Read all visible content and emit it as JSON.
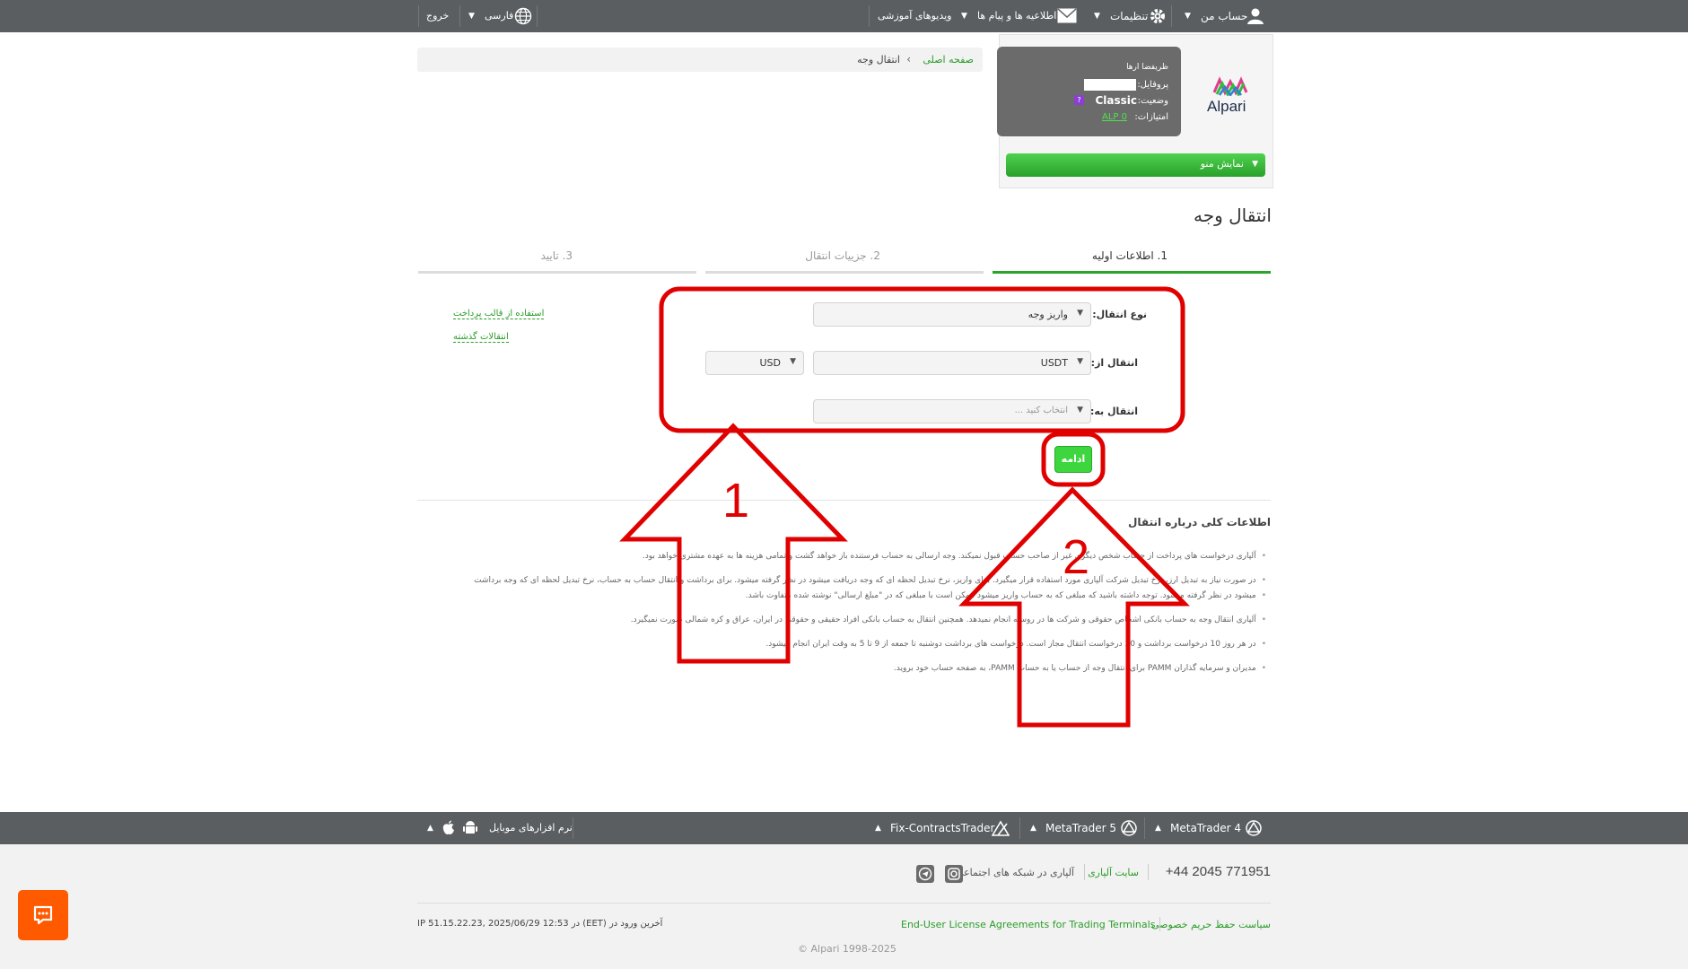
{
  "topbar": {
    "account": "حساب من",
    "settings": "تنظیمات",
    "messages": "اطلاعیه ها و پیام ها",
    "videos": "ویدیوهای آموزشی",
    "language": "فارسی",
    "logout": "خروج"
  },
  "breadcrumb": {
    "home": "صفحه اصلی",
    "current": "انتقال وجه"
  },
  "profile": {
    "name_label": "ظریفضا ارها",
    "profile_label": "پروفایل:",
    "status_label": "وضعیت:",
    "status_value": "Classic",
    "points_label": "امتیازات:",
    "points_value": "ALP 0",
    "menu_button": "نمایش منو",
    "logo_text": "Alpari"
  },
  "page": {
    "title": "انتقال وجه"
  },
  "steps": [
    {
      "label": "1. اطلاعات اولیه",
      "active": true
    },
    {
      "label": "2. جزییات انتقال",
      "active": false
    },
    {
      "label": "3. تایید",
      "active": false
    }
  ],
  "form": {
    "transfer_type": {
      "label": "نوع انتقال:",
      "value": "واریز وجه"
    },
    "from": {
      "label": "انتقال از:",
      "value": "USDT",
      "currency": "USD"
    },
    "to": {
      "label": "انتقال به:",
      "placeholder": "انتخاب کنید ..."
    },
    "continue_button": "ادامه",
    "links": {
      "template": "استفاده از قالب پرداخت",
      "history": "انتقالات گذشته"
    }
  },
  "info": {
    "title": "اطلاعات کلی درباره انتقال",
    "items": [
      "آلپاری درخواست های پرداخت از حساب شخص دیگری غیر از صاحب حساب قبول نمیکند. وجه ارسالی به حساب فرستنده باز خواهد گشت و تمامی هزینه ها به عهده مشتری خواهد بود.",
      "در صورت نیاز به تبدیل ارز، نرخ تبدیل شرکت آلپاری مورد استفاده قرار میگیرد. برای واریز، نرخ تبدیل لحظه ای که وجه دریافت میشود در نظر گرفته میشود. برای برداشت و انتقال حساب به حساب، نرخ تبدیل لحظه ای که وجه برداشت",
      "میشود در نظر گرفته میشود. توجه داشته باشید که مبلغی که به حساب واریز میشود ممکن است با مبلغی که در \"مبلغ ارسالی\" نوشته شده متفاوت باشد.",
      "آلپاری انتقال وجه به حساب بانکی اشخاص حقوقی و شرکت ها در روسیه انجام نمیدهد. همچنین انتقال به حساب بانکی افراد حقیقی و حقوقی در ایران، عراق و کره شمالی صورت نمیگیرد.",
      "در هر روز 10 درخواست برداشت و 30 درخواست انتقال مجاز است. درخواست های برداشت دوشنبه تا جمعه از 9 تا 5 به وقت ایران انجام میشود.",
      "مدیران و سرمایه گذاران PAMM برای انتقال وجه از حساب یا به حساب PAMM، به صفحه حساب خود بروید."
    ]
  },
  "platforms": {
    "mt4": "MetaTrader 4",
    "mt5": "MetaTrader 5",
    "fix": "Fix-ContractsTrader",
    "mobile": "نرم افزارهای موبایل"
  },
  "footer": {
    "phone": "+44 2045 771951",
    "site_link": "سایت آلپاری",
    "social_text": "آلپاری در شبکه های اجتماعی",
    "privacy": "سیاست حفظ حریم خصوصی",
    "eula": "End-User License Agreements for Trading Terminals",
    "last_login": "IP 51.15.22.23, 2025/06/29 در 12:53 (EET) آخرین ورود در",
    "copyright": "© Alpari 1998-2025"
  },
  "annotations": {
    "label_1": "1",
    "label_2": "2",
    "color": "#e00000"
  }
}
